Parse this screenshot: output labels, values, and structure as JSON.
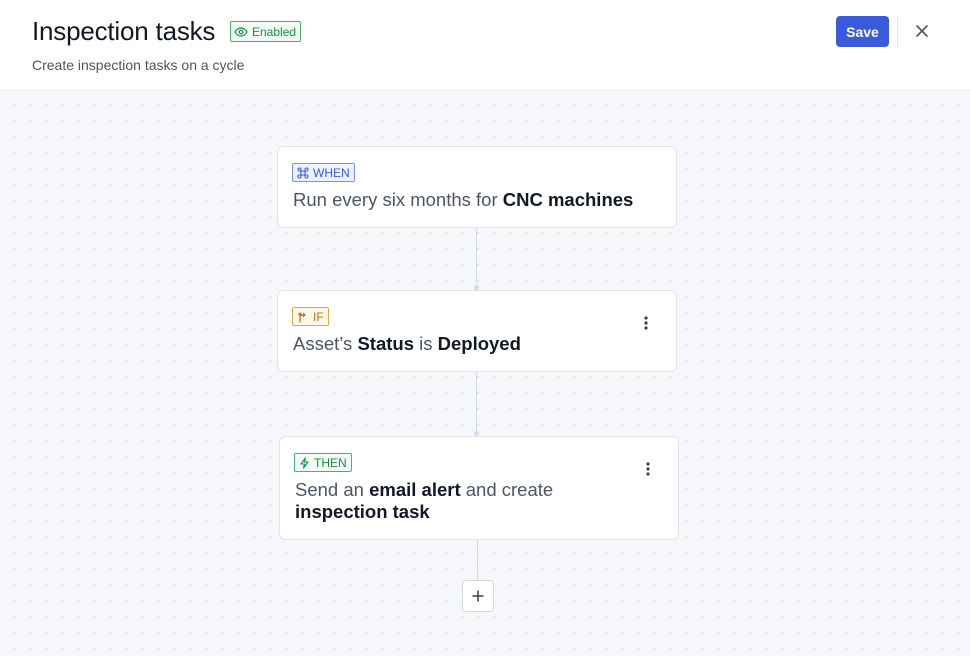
{
  "header": {
    "title": "Inspection tasks",
    "status_badge": "Enabled",
    "subtitle": "Create inspection tasks on a cycle",
    "save_label": "Save",
    "close_icon": "close-icon",
    "eye_icon": "eye-icon"
  },
  "colors": {
    "accent": "#3b5bdb",
    "enabled_green": "#1f8a46",
    "if_orange": "#b8711a",
    "canvas_bg": "#f6f7fb"
  },
  "flow": {
    "when": {
      "tag": "WHEN",
      "icon": "command-icon",
      "text_pre": "Run every six months for ",
      "text_bold": "CNC machines"
    },
    "if": {
      "tag": "IF",
      "icon": "branch-icon",
      "t1": "Asset’s ",
      "b1": "Status",
      "t2": " is ",
      "b2": "Deployed"
    },
    "then": {
      "tag": "THEN",
      "icon": "lightning-icon",
      "t1": "Send an ",
      "b1": "email alert",
      "t2": " and create ",
      "b2": "inspection task"
    },
    "add_icon": "plus-icon",
    "menu_icon": "more-vertical-icon"
  }
}
